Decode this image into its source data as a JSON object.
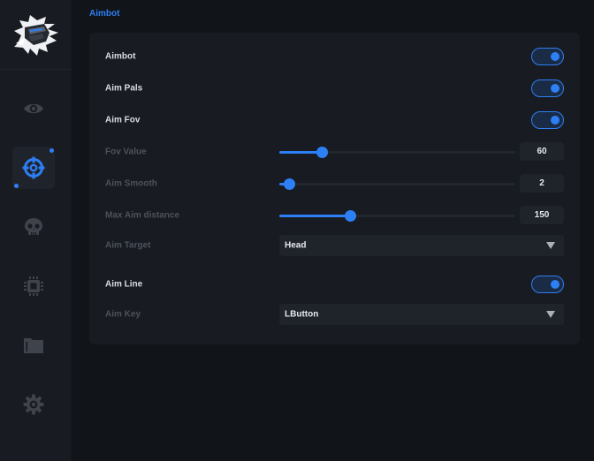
{
  "header": {
    "section_title": "Aimbot"
  },
  "colors": {
    "accent": "#2d7ff5",
    "icon_idle": "#3e434c",
    "panel": "#181b21",
    "background": "#111419"
  },
  "sidebar": {
    "logo": "knight-helmet-logo",
    "items": [
      {
        "icon": "eye-icon",
        "active": false
      },
      {
        "icon": "crosshair-icon",
        "active": true
      },
      {
        "icon": "skull-icon",
        "active": false
      },
      {
        "icon": "chip-icon",
        "active": false
      },
      {
        "icon": "folder-icon",
        "active": false
      },
      {
        "icon": "gear-icon",
        "active": false
      }
    ]
  },
  "settings": {
    "aimbot": {
      "label": "Aimbot",
      "enabled": true
    },
    "aim_pals": {
      "label": "Aim Pals",
      "enabled": true
    },
    "aim_fov": {
      "label": "Aim Fov",
      "enabled": true
    },
    "fov_value": {
      "label": "Fov Value",
      "value": "60",
      "fraction": 0.18
    },
    "aim_smooth": {
      "label": "Aim Smooth",
      "value": "2",
      "fraction": 0.04
    },
    "max_aim_distance": {
      "label": "Max Aim distance",
      "value": "150",
      "fraction": 0.3
    },
    "aim_target": {
      "label": "Aim Target",
      "selected": "Head"
    },
    "aim_line": {
      "label": "Aim Line",
      "enabled": true
    },
    "aim_key": {
      "label": "Aim Key",
      "selected": "LButton"
    }
  }
}
